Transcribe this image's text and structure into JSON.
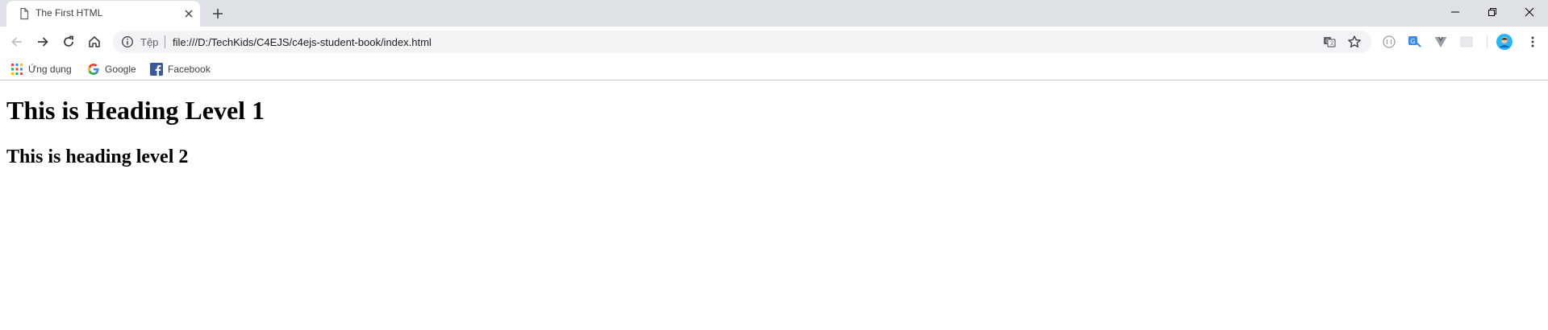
{
  "tab": {
    "title": "The First HTML"
  },
  "omnibox": {
    "scheme_label": "Tệp",
    "url": "file:///D:/TechKids/C4EJS/c4ejs-student-book/index.html"
  },
  "bookmarks": [
    {
      "label": "Ứng dụng",
      "icon": "apps-grid-icon"
    },
    {
      "label": "Google",
      "icon": "google-icon"
    },
    {
      "label": "Facebook",
      "icon": "facebook-icon"
    }
  ],
  "page": {
    "heading1": "This is Heading Level 1",
    "heading2": "This is heading level 2"
  },
  "colors": {
    "tabstrip": "#dee1e6",
    "omnibox": "#f1f3f4",
    "icon": "#5f6368",
    "facebook": "#3b5998"
  }
}
